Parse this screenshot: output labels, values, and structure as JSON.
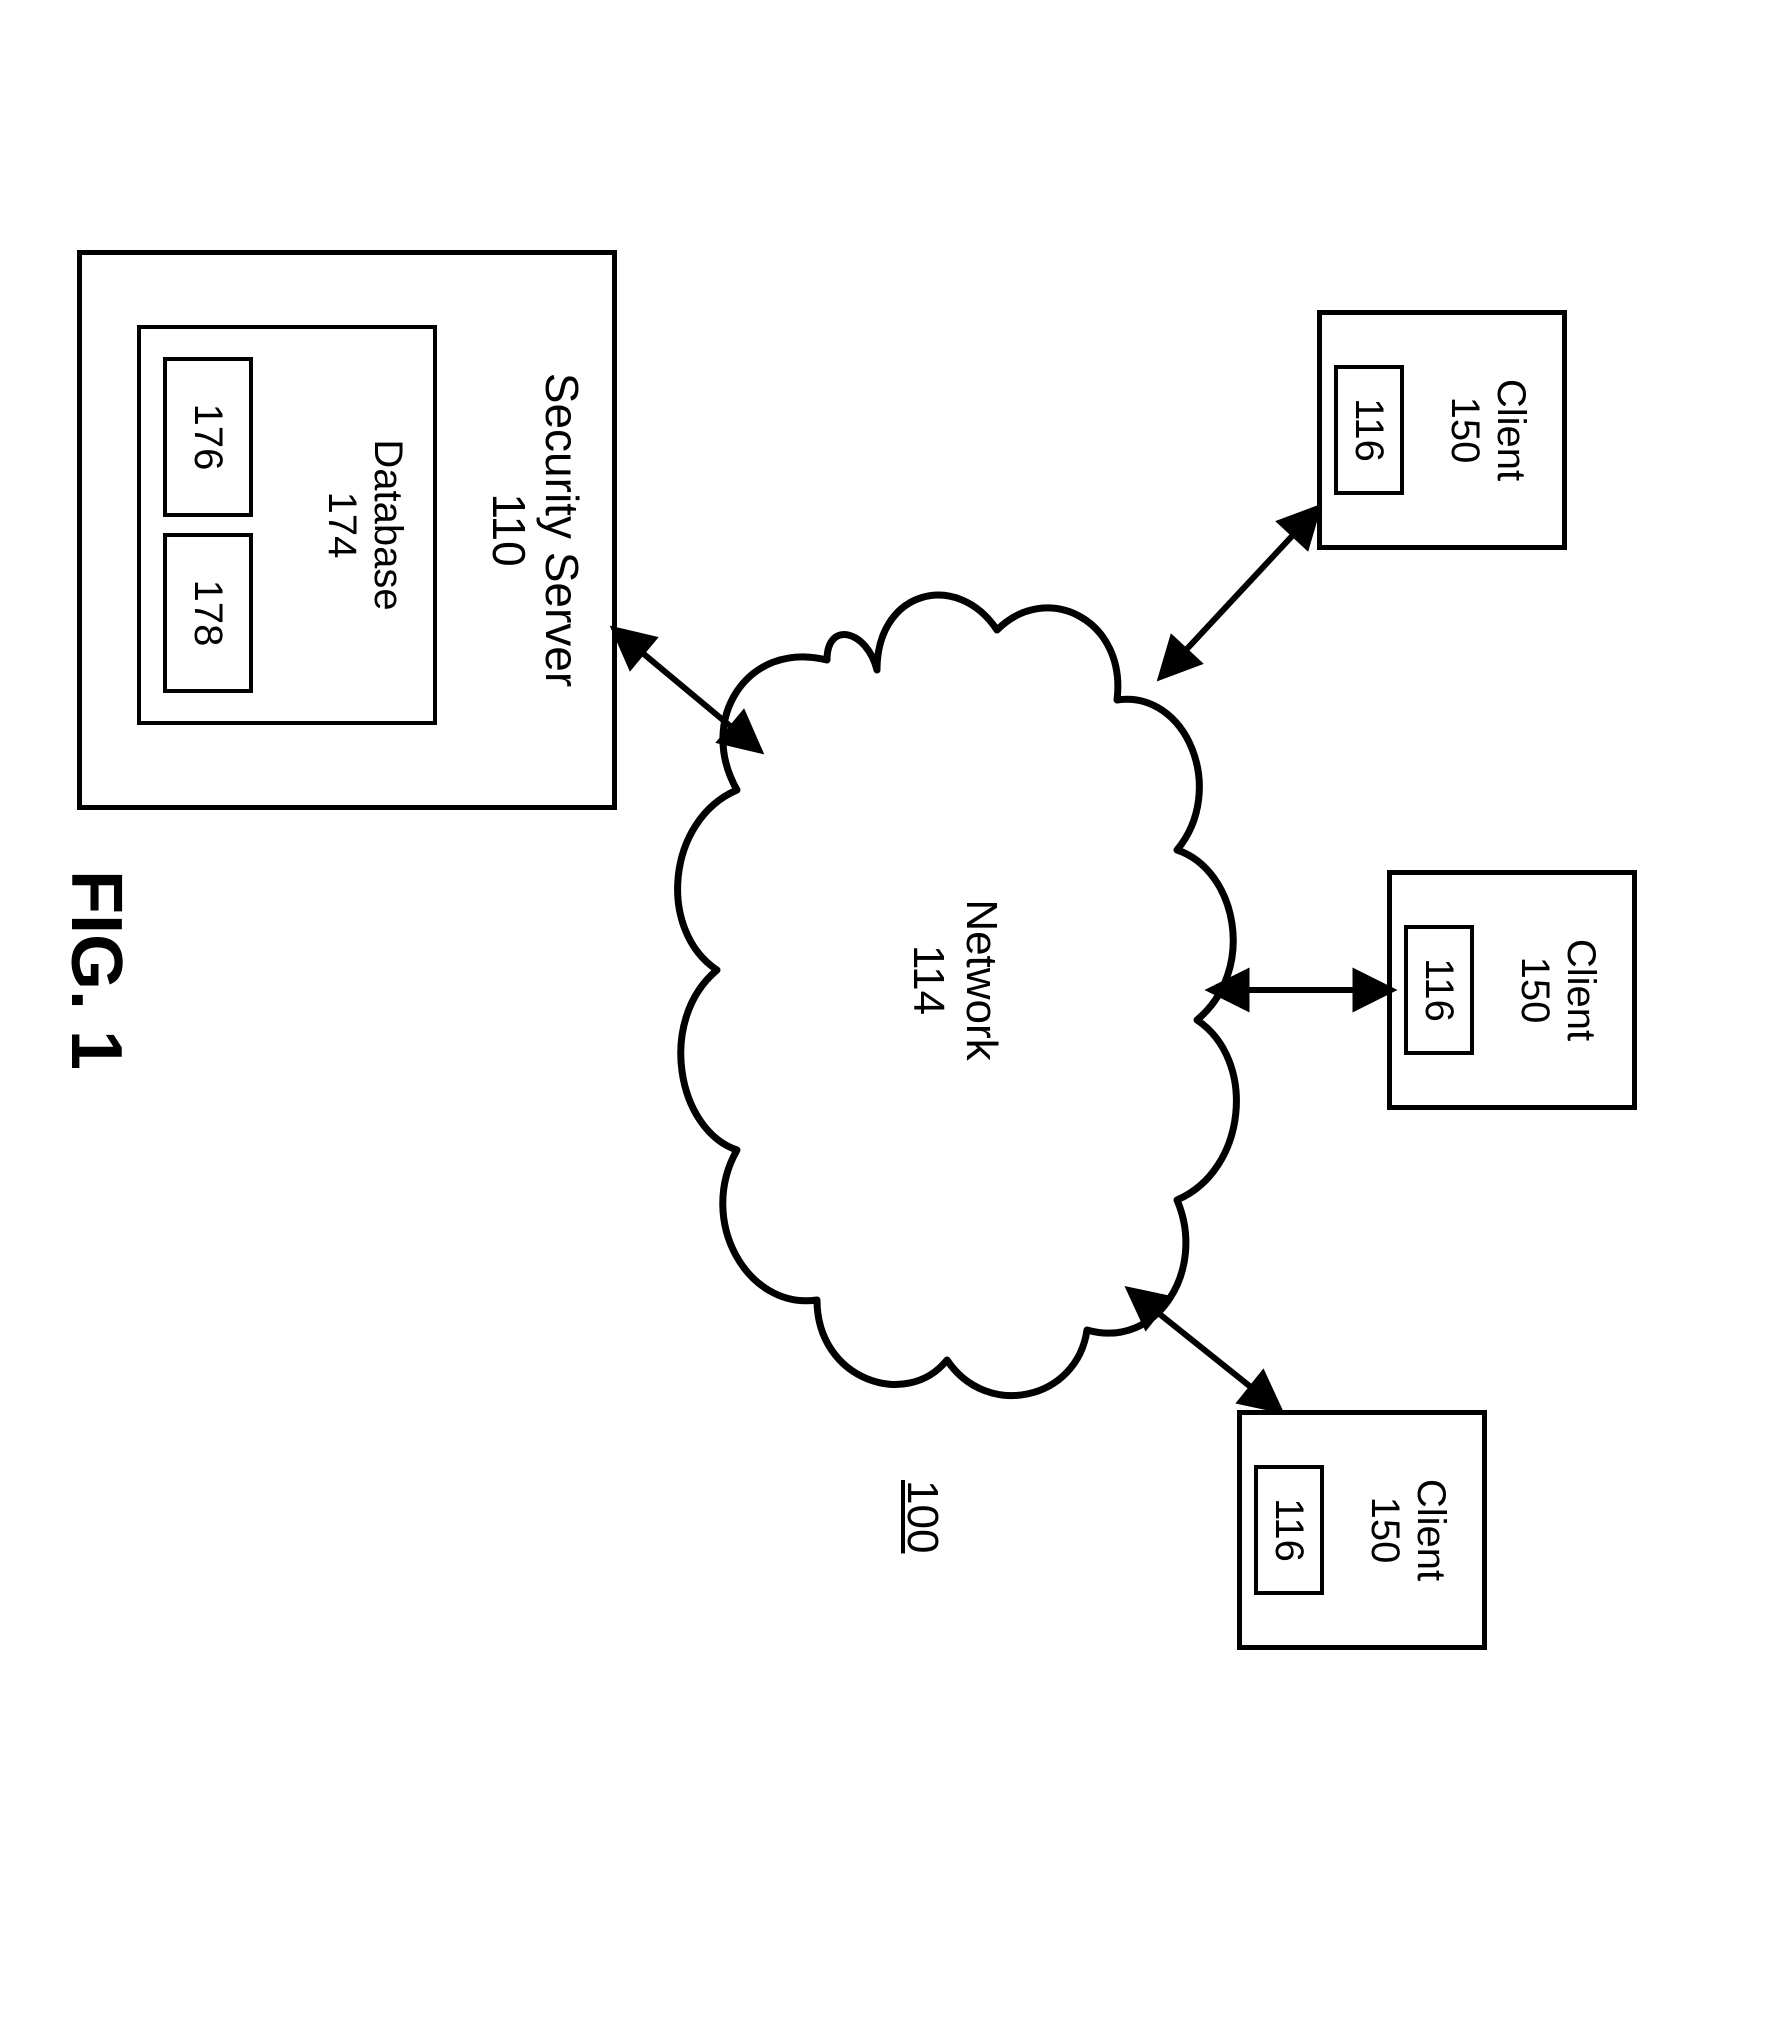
{
  "figure": {
    "caption": "FIG. 1",
    "ref": "100"
  },
  "network": {
    "label": "Network",
    "ref": "114"
  },
  "clients": [
    {
      "label": "Client",
      "ref": "150",
      "inner_ref": "116"
    },
    {
      "label": "Client",
      "ref": "150",
      "inner_ref": "116"
    },
    {
      "label": "Client",
      "ref": "150",
      "inner_ref": "116"
    }
  ],
  "server": {
    "label": "Security Server",
    "ref": "110",
    "database": {
      "label": "Database",
      "ref": "174",
      "cells": [
        "176",
        "178"
      ]
    }
  }
}
